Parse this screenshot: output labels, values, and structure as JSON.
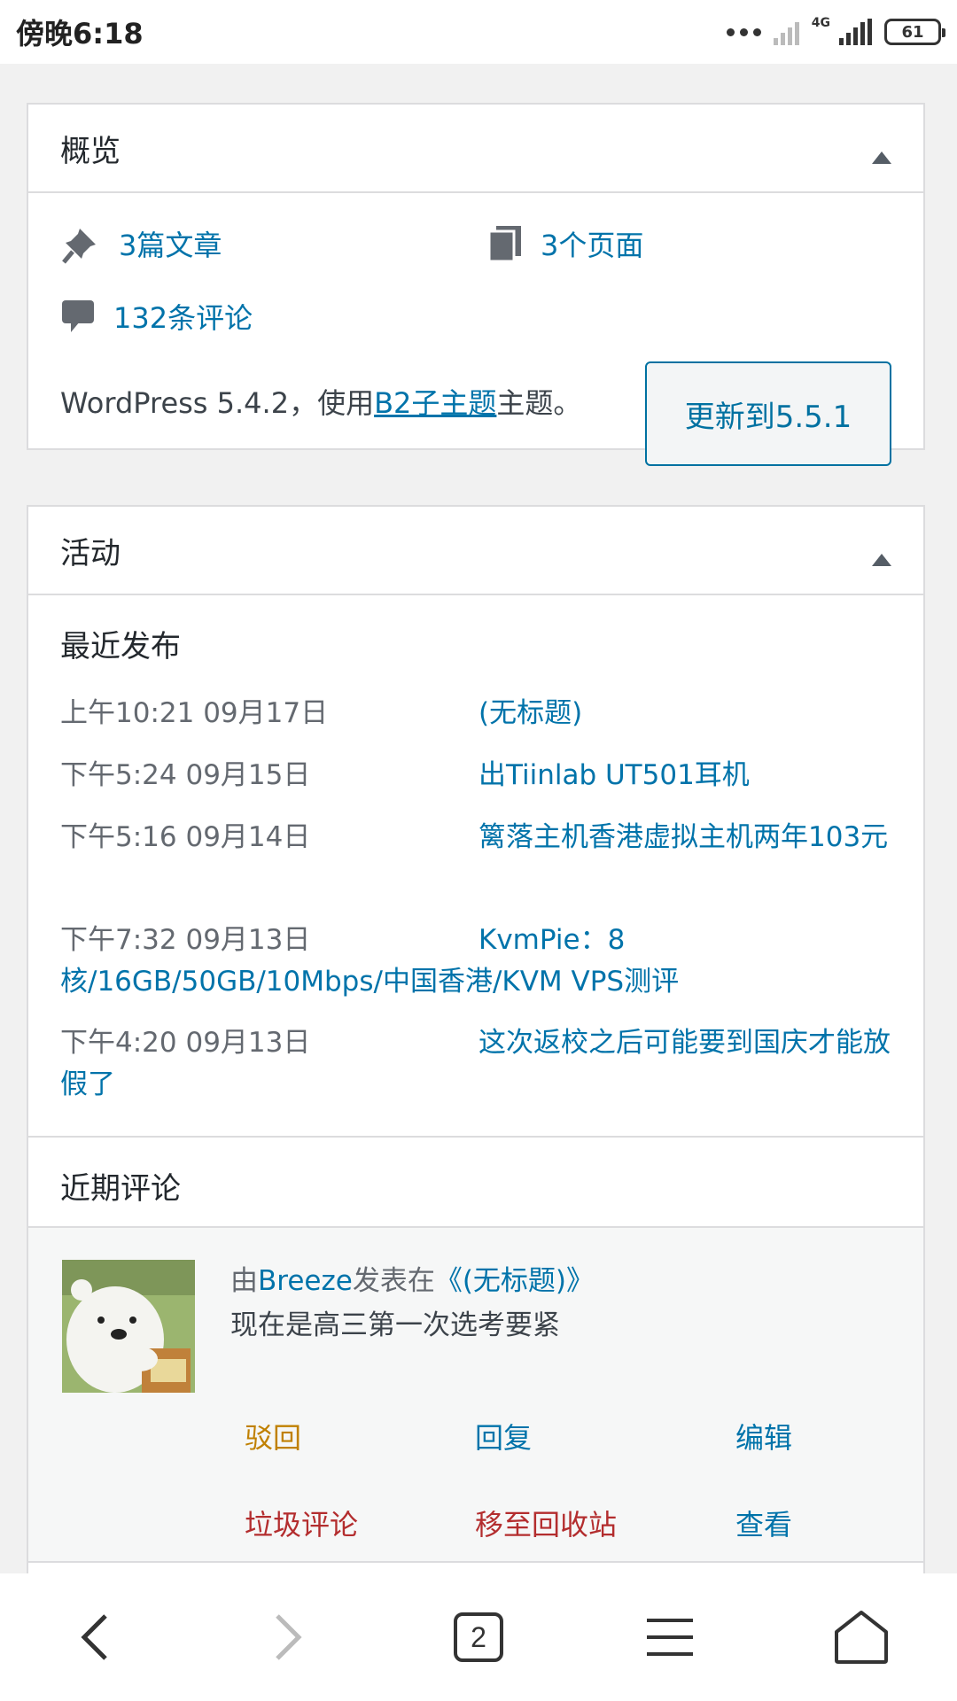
{
  "status_bar": {
    "time": "傍晚6:18",
    "network": "4G",
    "battery": "61"
  },
  "overview": {
    "title": "概览",
    "posts": "3篇文章",
    "pages": "3个页面",
    "comments": "132条评论",
    "wp_prefix": "WordPress 5.4.2，使用",
    "theme_link": "B2子主题",
    "wp_suffix": "主题。",
    "update_button": "更新到5.5.1"
  },
  "activity": {
    "title": "活动",
    "recent_published_title": "最近发布",
    "posts": [
      {
        "date": "上午10:21 09月17日",
        "title": "(无标题)"
      },
      {
        "date": "下午5:24 09月15日",
        "title": "出Tiinlab UT501耳机"
      },
      {
        "date": "下午5:16 09月14日",
        "title": "篱落主机香港虚拟主机两年103元"
      },
      {
        "date": "下午7:32 09月13日",
        "title": "KvmPie：8核/16GB/50GB/10Mbps/中国香港/KVM VPS测评"
      },
      {
        "date": "下午4:20 09月13日",
        "title": "这次返校之后可能要到国庆才能放假了"
      }
    ],
    "recent_comments_title": "近期评论",
    "comment": {
      "prefix": "由",
      "author": "Breeze",
      "middle": "发表在",
      "post_link": "《(无标题)》",
      "text": "现在是高三第一次选考要紧",
      "actions": {
        "unapprove": "驳回",
        "reply": "回复",
        "edit": "编辑",
        "spam": "垃圾评论",
        "trash": "移至回收站",
        "view": "查看"
      }
    }
  },
  "bottom_nav": {
    "tabs_count": "2"
  }
}
